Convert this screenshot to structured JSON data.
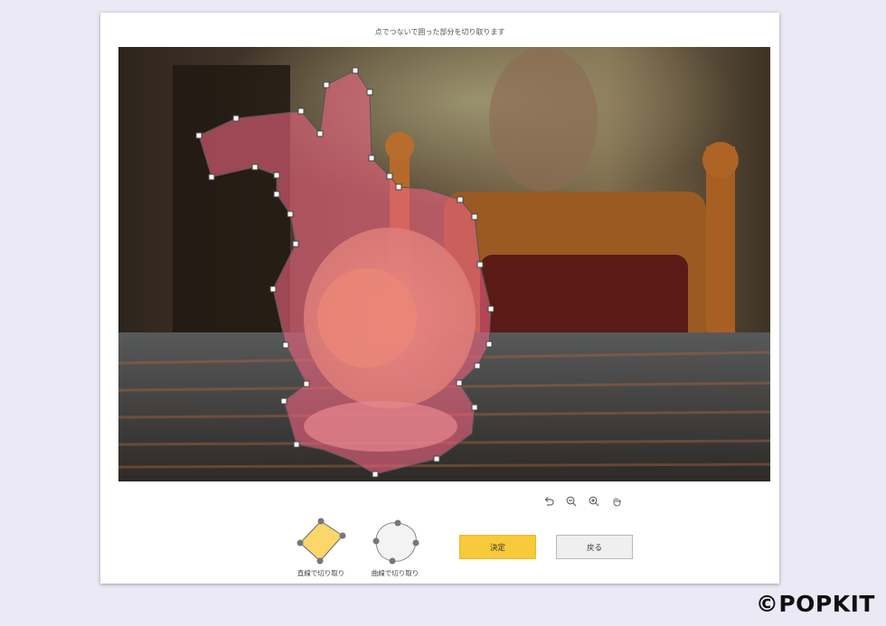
{
  "editor": {
    "instruction": "点でつないで囲った部分を切り取ります"
  },
  "toolbar": {
    "tools": [
      {
        "name": "undo-icon"
      },
      {
        "name": "zoom-out-icon"
      },
      {
        "name": "zoom-in-icon"
      },
      {
        "name": "hand-pan-icon"
      }
    ]
  },
  "modes": {
    "straight_label": "直線で切り取り",
    "curve_label": "曲線で切り取り",
    "selected": "straight"
  },
  "actions": {
    "confirm_label": "決定",
    "back_label": "戻る"
  },
  "colors": {
    "accent": "#f7c93b",
    "selection_fill": "#e8637e",
    "selection_stroke": "#555555",
    "handle_fill": "#ffffff"
  },
  "watermark": {
    "text": "©POPKIT"
  }
}
